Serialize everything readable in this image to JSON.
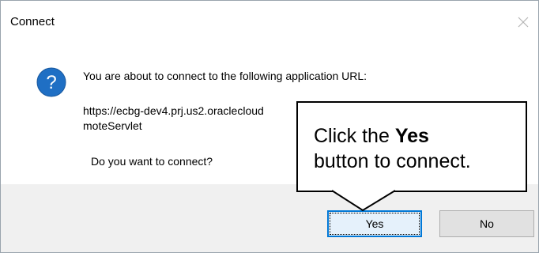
{
  "dialog": {
    "title": "Connect",
    "message": "You are about to connect to the following application URL:",
    "url_line_1": "https://ecbg-dev4.prj.us2.oraclecloud",
    "url_line_2": "moteServlet",
    "question": "Do you want to connect?",
    "icon": "question-icon",
    "close_icon": "close-icon"
  },
  "buttons": {
    "yes_label": "Yes",
    "no_label": "No"
  },
  "callout": {
    "text_before": "Click the ",
    "text_bold": "Yes",
    "text_after": "button to connect."
  },
  "colors": {
    "accent": "#0078d7",
    "button_bar": "#f0f0f0",
    "question_icon": "#1f6fc4"
  }
}
